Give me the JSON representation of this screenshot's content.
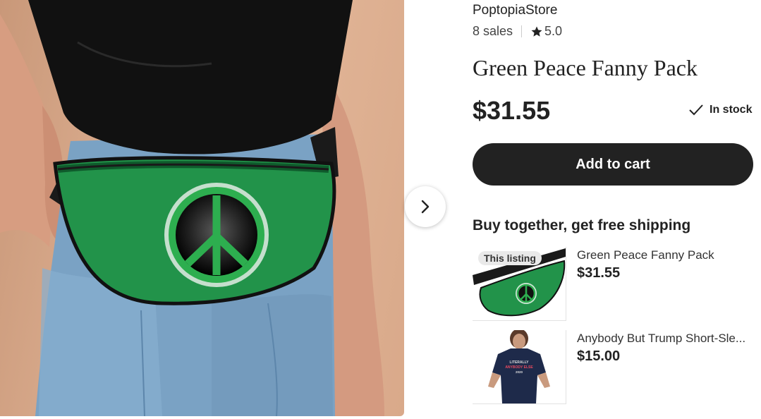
{
  "product": {
    "store_name": "PoptopiaStore",
    "sales": "8 sales",
    "rating": "5.0",
    "title": "Green Peace Fanny Pack",
    "price": "$31.55",
    "stock": "In stock",
    "add_to_cart_label": "Add to cart"
  },
  "gallery": {
    "next_icon": "chevron-right-icon"
  },
  "bundle": {
    "heading": "Buy together, get free shipping",
    "items": [
      {
        "badge": "This listing",
        "name": "Green Peace Fanny Pack",
        "price": "$31.55"
      },
      {
        "name": "Anybody But Trump Short-Sle...",
        "price": "$15.00",
        "shirt_text": [
          "LITERALLY",
          "ANYBODY ELSE",
          "2020"
        ]
      }
    ]
  },
  "colors": {
    "button_bg": "#222222",
    "bag_green": "#22934a",
    "shirt_navy": "#1e2a4a"
  }
}
